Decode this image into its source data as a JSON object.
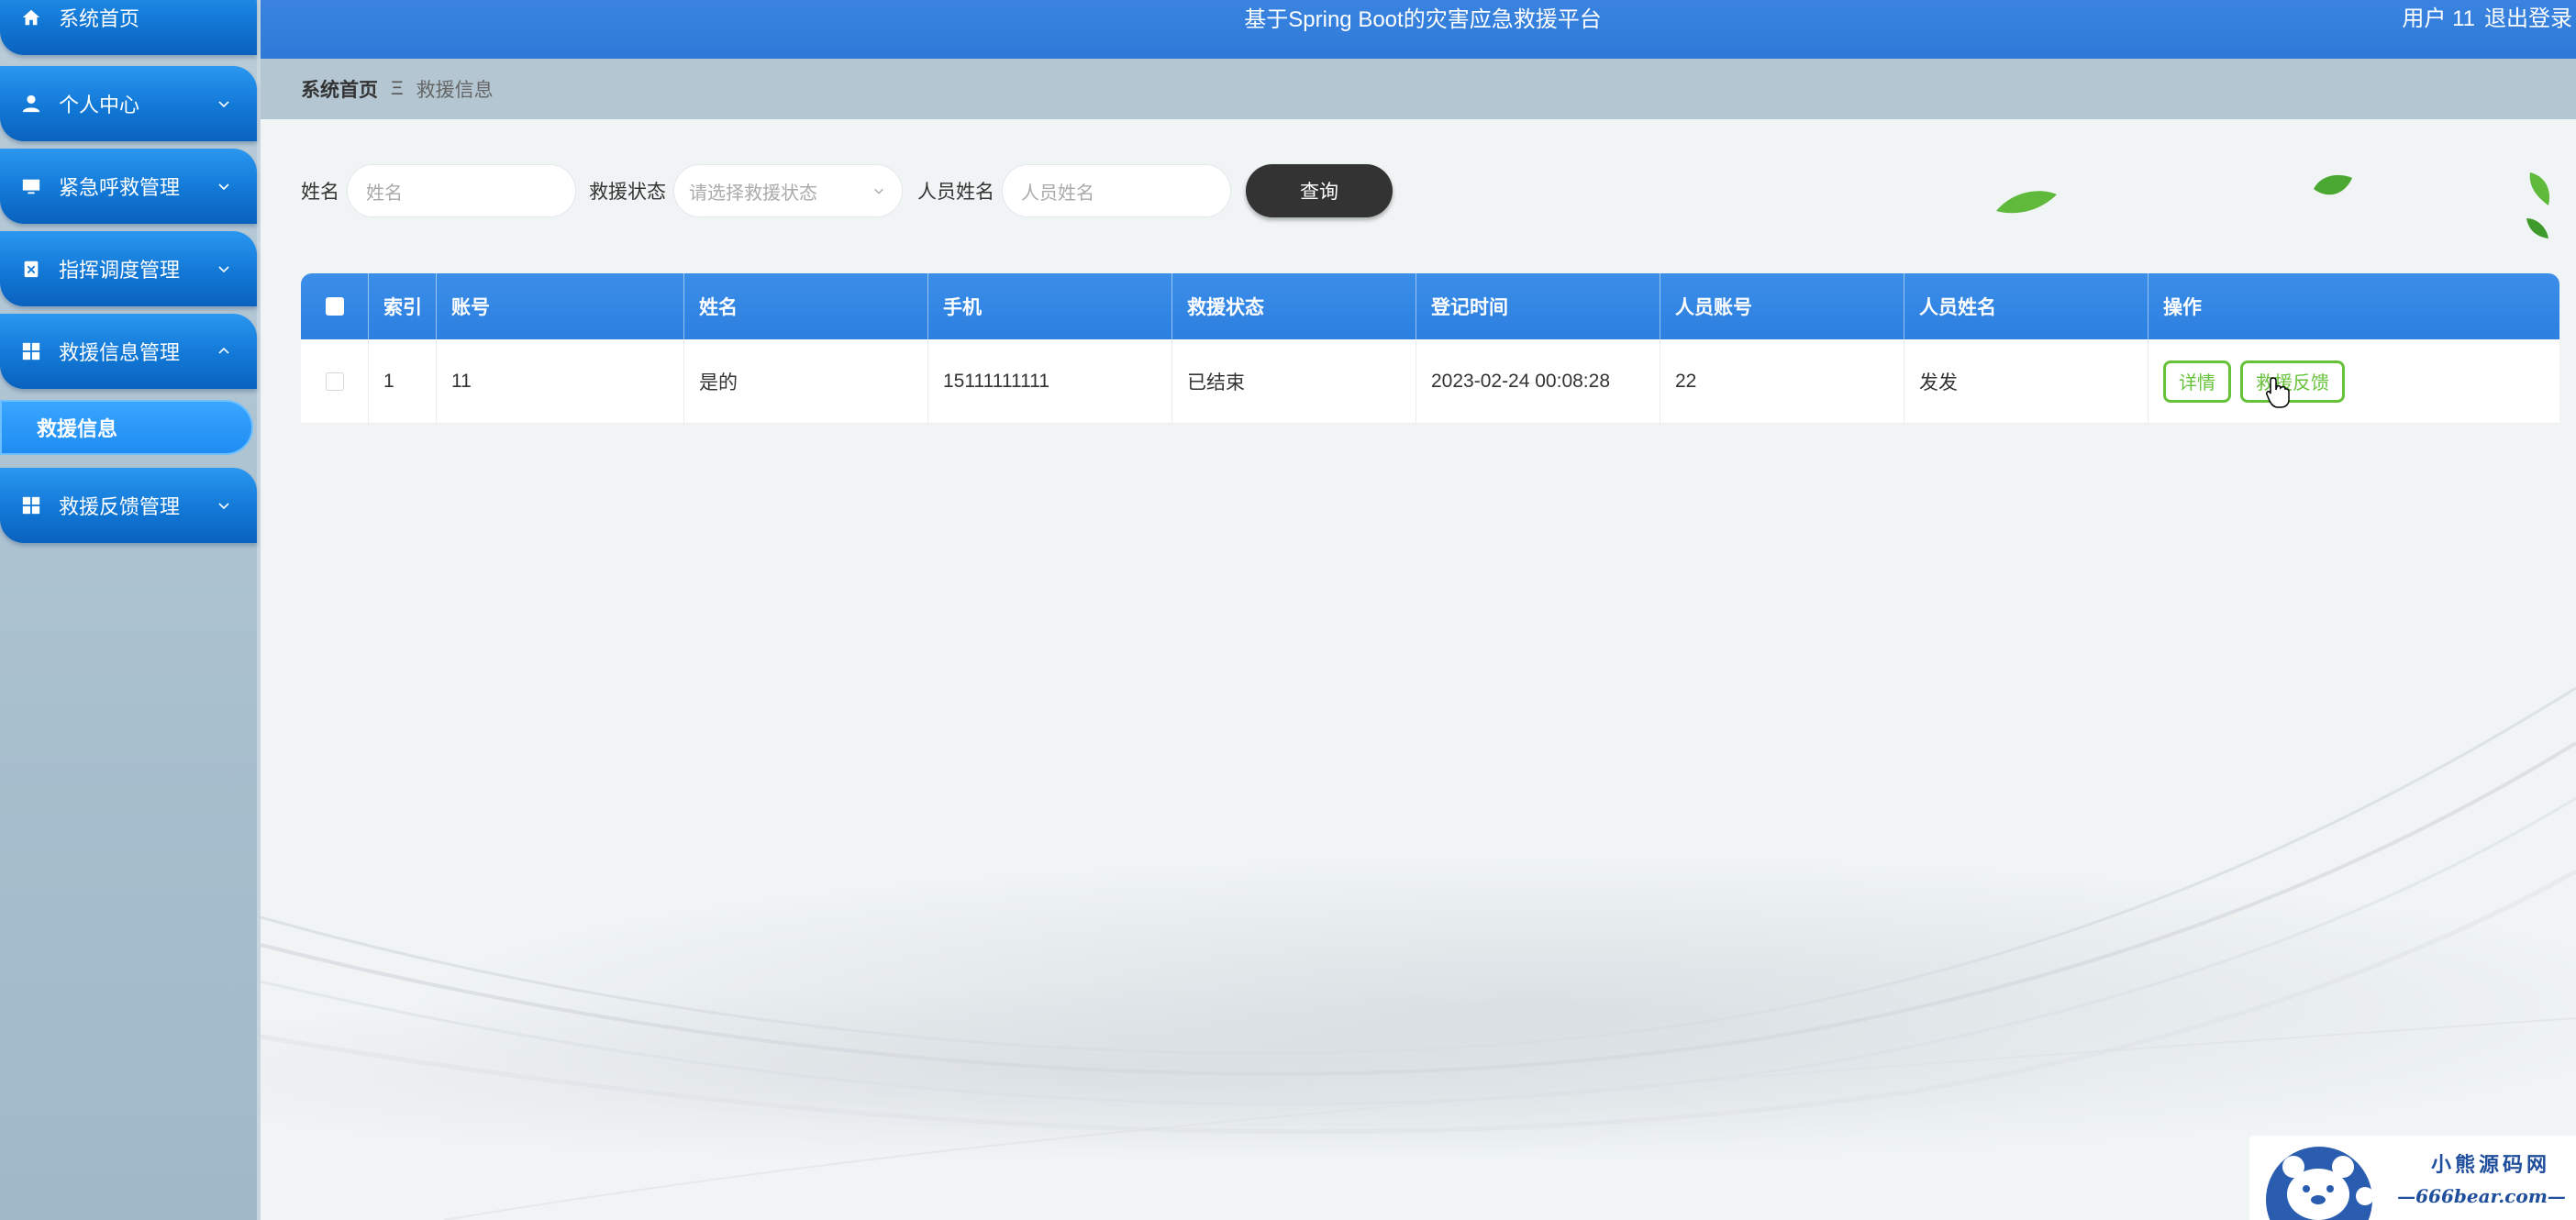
{
  "header": {
    "title": "基于Spring Boot的灾害应急救援平台",
    "user": "用户 11",
    "logout": "退出登录"
  },
  "sidebar": {
    "items": [
      {
        "label": "系统首页",
        "icon": "home-icon"
      },
      {
        "label": "个人中心",
        "icon": "person-icon"
      },
      {
        "label": "紧急呼救管理",
        "icon": "monitor-icon"
      },
      {
        "label": "指挥调度管理",
        "icon": "clipboard-icon"
      },
      {
        "label": "救援信息管理",
        "icon": "grid-icon"
      },
      {
        "label": "救援反馈管理",
        "icon": "grid-icon"
      }
    ],
    "active_sub": "救援信息"
  },
  "breadcrumb": {
    "home": "系统首页",
    "separator": "Ξ",
    "current": "救援信息"
  },
  "search": {
    "name_label": "姓名",
    "name_placeholder": "姓名",
    "status_label": "救援状态",
    "status_placeholder": "请选择救援状态",
    "staff_label": "人员姓名",
    "staff_placeholder": "人员姓名",
    "query_button": "查询"
  },
  "table": {
    "headers": [
      "索引",
      "账号",
      "姓名",
      "手机",
      "救援状态",
      "登记时间",
      "人员账号",
      "人员姓名",
      "操作"
    ],
    "rows": [
      {
        "index": "1",
        "account": "11",
        "name": "是的",
        "phone": "15111111111",
        "status": "已结束",
        "time": "2023-02-24 00:08:28",
        "staff_account": "22",
        "staff_name": "发发",
        "actions": [
          "详情",
          "救援反馈"
        ]
      }
    ]
  },
  "watermark": {
    "line1": "小熊源码网",
    "line2": "—666bear.com—"
  },
  "colors": {
    "header": "#2f79d8",
    "sidebar_item": "#1278d6",
    "action_green": "#67c23a",
    "query_button": "#333333"
  }
}
